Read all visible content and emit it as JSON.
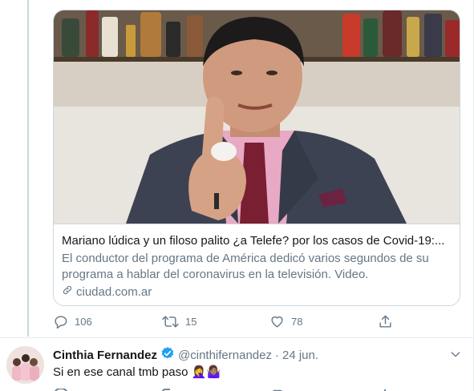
{
  "card": {
    "title": "Mariano lúdica y un filoso palito ¿a Telefe? por los casos de Covid-19:...",
    "description": "El conductor del programa de América dedicó varios segundos de su programa a hablar del coronavirus en la televisión. Video.",
    "domain": "ciudad.com.ar"
  },
  "actions": {
    "reply_count": "106",
    "retweet_count": "15",
    "like_count": "78"
  },
  "tweet2": {
    "name": "Cinthia Fernandez",
    "handle": "@cinthifernandez",
    "separator": "·",
    "time": "24 jun.",
    "text": "Si en ese canal tmb paso",
    "emoji": "🤦‍♀️🤷🏽‍♀️"
  },
  "icons": [
    "reply-icon",
    "retweet-icon",
    "like-icon",
    "share-icon",
    "verified-icon",
    "link-icon",
    "chevron-down-icon"
  ],
  "colors": {
    "secondary_text": "#657786",
    "primary_text": "#14171a",
    "verified": "#1da1f2",
    "border": "#ccd6dd"
  }
}
